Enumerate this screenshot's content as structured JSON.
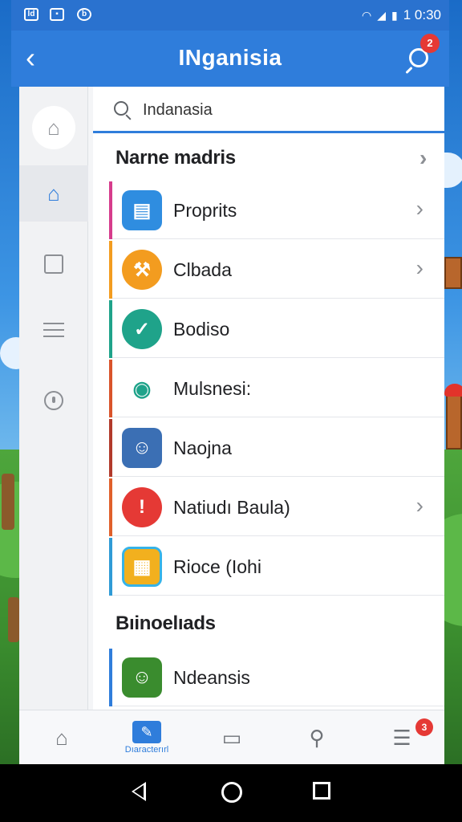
{
  "status_bar": {
    "time": "1 0:30"
  },
  "app_bar": {
    "title": "INganisia",
    "badge": "2"
  },
  "search": {
    "value": "Indanasia"
  },
  "section1": {
    "title": "Narne madris"
  },
  "items": [
    {
      "label": "Proprits",
      "icon": "document-icon",
      "accent": "#d63c8c",
      "has_chevron": true
    },
    {
      "label": "Clbada",
      "icon": "tools-icon",
      "accent": "#f39c1f",
      "has_chevron": true
    },
    {
      "label": "Bodiso",
      "icon": "activity-icon",
      "accent": "#1fa38a",
      "has_chevron": false
    },
    {
      "label": "Mulsnesi:",
      "icon": "eye-icon",
      "accent": "#d9542b",
      "has_chevron": false
    },
    {
      "label": "Naojna",
      "icon": "game-character-icon",
      "accent": "#b23a2b",
      "has_chevron": false
    },
    {
      "label": "Natiudı Baula)",
      "icon": "alert-icon",
      "accent": "#e0602b",
      "has_chevron": true
    },
    {
      "label": "Rioce (Iohi",
      "icon": "chip-icon",
      "accent": "#2f9bd6",
      "has_chevron": false
    }
  ],
  "section2": {
    "title": "Bıinoelıads"
  },
  "items2": [
    {
      "label": "Ndeansis",
      "icon": "game-character-icon",
      "accent": "#2f7ddb",
      "has_chevron": false
    }
  ],
  "bottom_nav": {
    "active_label": "Dıaracterırl",
    "badge": "3"
  }
}
